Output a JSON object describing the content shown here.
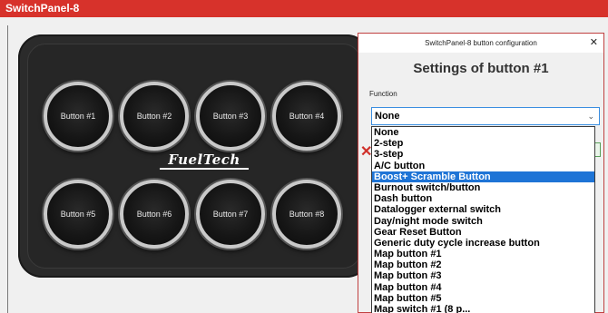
{
  "window": {
    "title": "SwitchPanel-8"
  },
  "device": {
    "brand": "FuelTech",
    "buttons": [
      "Button #1",
      "Button #2",
      "Button #3",
      "Button #4",
      "Button #5",
      "Button #6",
      "Button #7",
      "Button #8"
    ]
  },
  "dialog": {
    "title": "SwitchPanel-8 button configuration",
    "close": "✕",
    "heading": "Settings of button #1",
    "function_label": "Function",
    "selected_value": "None",
    "caret": "⌄",
    "options": [
      "None",
      "2-step",
      "3-step",
      "A/C button",
      "Boost+ Scramble Button",
      "Burnout switch/button",
      "Dash button",
      "Datalogger external switch",
      "Day/night mode switch",
      "Gear Reset Button",
      "Generic duty cycle increase button",
      "Map button #1",
      "Map button #2",
      "Map button #3",
      "Map button #4",
      "Map button #5",
      "Map switch #1 (8 p..."
    ],
    "highlighted_option": "Boost+ Scramble Button"
  },
  "side_icons": {
    "cancel": "✕"
  }
}
